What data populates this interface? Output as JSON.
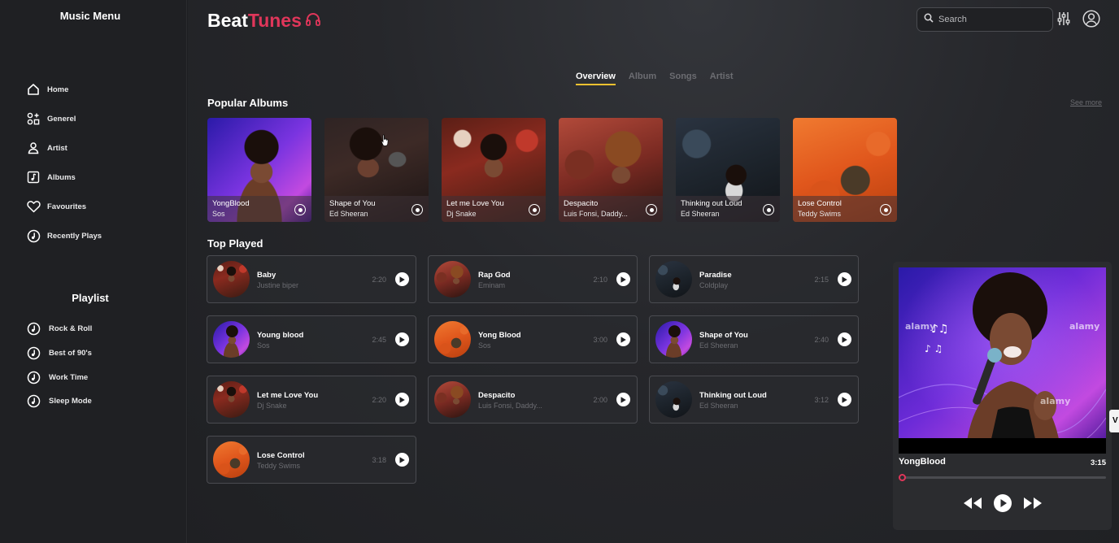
{
  "sidebar": {
    "title": "Music Menu",
    "nav": [
      {
        "label": "Home",
        "icon": "home-icon"
      },
      {
        "label": "Generel",
        "icon": "genre-icon"
      },
      {
        "label": "Artist",
        "icon": "user-icon"
      },
      {
        "label": "Albums",
        "icon": "album-icon"
      },
      {
        "label": "Favourites",
        "icon": "heart-icon"
      },
      {
        "label": "Recently Plays",
        "icon": "recent-music-icon"
      }
    ],
    "playlist_title": "Playlist",
    "playlists": [
      {
        "label": "Rock & Roll"
      },
      {
        "label": "Best of 90's"
      },
      {
        "label": "Work Time"
      },
      {
        "label": "Sleep Mode"
      }
    ]
  },
  "header": {
    "logo_part1": "Beat",
    "logo_part2": "Tunes",
    "search_placeholder": "Search"
  },
  "tabs": [
    {
      "label": "Overview",
      "active": true
    },
    {
      "label": "Album",
      "active": false
    },
    {
      "label": "Songs",
      "active": false
    },
    {
      "label": "Artist",
      "active": false
    }
  ],
  "popular": {
    "title": "Popular Albums",
    "see_more": "See more",
    "albums": [
      {
        "title": "YongBlood",
        "artist": "Sos",
        "art": "purple"
      },
      {
        "title": "Shape of You",
        "artist": "Ed Sheeran",
        "art": "dark"
      },
      {
        "title": "Let me Love You",
        "artist": "Dj Snake",
        "art": "red"
      },
      {
        "title": "Despacito",
        "artist": "Luis Fonsi, Daddy...",
        "art": "warm"
      },
      {
        "title": "Thinking out Loud",
        "artist": "Ed Sheeran",
        "art": "night"
      },
      {
        "title": "Lose Control",
        "artist": "Teddy Swims",
        "art": "orange"
      }
    ]
  },
  "top_played": {
    "title": "Top Played",
    "tracks": [
      {
        "title": "Baby",
        "artist": "Justine biper",
        "duration": "2:20",
        "art": "red"
      },
      {
        "title": "Rap God",
        "artist": "Eminam",
        "duration": "2:10",
        "art": "warm"
      },
      {
        "title": "Paradise",
        "artist": "Coldplay",
        "duration": "2:15",
        "art": "night"
      },
      {
        "title": "Young blood",
        "artist": "Sos",
        "duration": "2:45",
        "art": "purple"
      },
      {
        "title": "Yong Blood",
        "artist": "Sos",
        "duration": "3:00",
        "art": "orange"
      },
      {
        "title": "Shape of You",
        "artist": "Ed Sheeran",
        "duration": "2:40",
        "art": "purple"
      },
      {
        "title": "Let me Love You",
        "artist": "Dj Snake",
        "duration": "2:20",
        "art": "red"
      },
      {
        "title": "Despacito",
        "artist": "Luis Fonsi, Daddy...",
        "duration": "2:00",
        "art": "warm"
      },
      {
        "title": "Thinking out Loud",
        "artist": "Ed Sheeran",
        "duration": "3:12",
        "art": "night"
      },
      {
        "title": "Lose Control",
        "artist": "Teddy Swims",
        "duration": "3:18",
        "art": "orange"
      }
    ]
  },
  "player": {
    "title": "YongBlood",
    "time": "3:15",
    "progress": 0,
    "cover_watermark": "alamy"
  },
  "side_tab": "V",
  "colors": {
    "accent": "#e0365a",
    "tab_underline": "#f2c230"
  }
}
